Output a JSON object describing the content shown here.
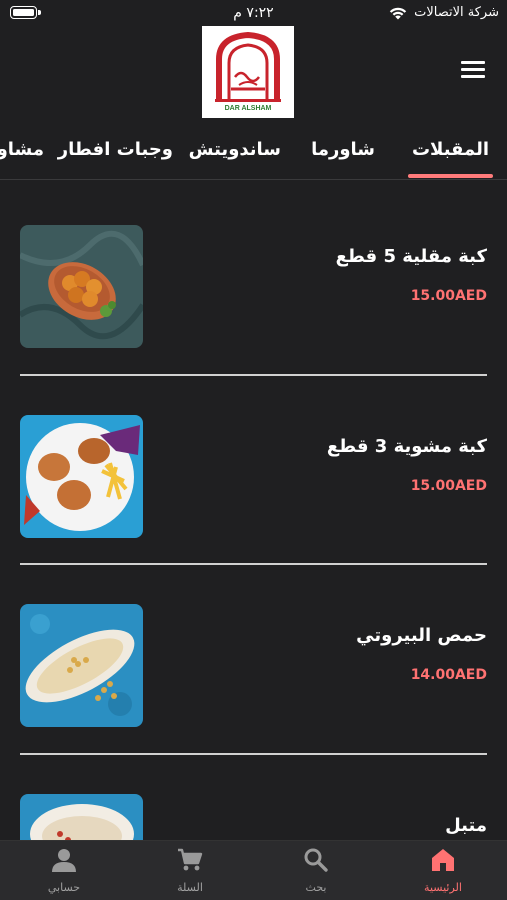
{
  "status_bar": {
    "time": "٧:٢٢ م",
    "carrier": "شركة الاتصالات"
  },
  "header": {
    "logo_text": "DAR ALSHAM",
    "menu_icon": "hamburger-menu-icon"
  },
  "tabs": [
    {
      "label": "المقبلات",
      "active": true
    },
    {
      "label": "شاورما",
      "active": false
    },
    {
      "label": "ساندويتش",
      "active": false
    },
    {
      "label": "وجبات افطار",
      "active": false
    },
    {
      "label": "مشاوي",
      "active": false
    }
  ],
  "items": [
    {
      "name": "كبة مقلية 5 قطع",
      "price": "15.00AED"
    },
    {
      "name": "كبة مشوية 3 قطع",
      "price": "15.00AED"
    },
    {
      "name": "حمص البيروتي",
      "price": "14.00AED"
    },
    {
      "name": "متبل",
      "price": ""
    }
  ],
  "bottom_nav": [
    {
      "label": "الرئيسية",
      "icon": "home-icon",
      "active": true
    },
    {
      "label": "بحث",
      "icon": "search-icon",
      "active": false
    },
    {
      "label": "السلة",
      "icon": "cart-icon",
      "active": false
    },
    {
      "label": "حسابي",
      "icon": "user-icon",
      "active": false
    }
  ],
  "colors": {
    "background": "#1f1f21",
    "accent": "#ff7272",
    "nav_background": "#2b2b2d"
  }
}
